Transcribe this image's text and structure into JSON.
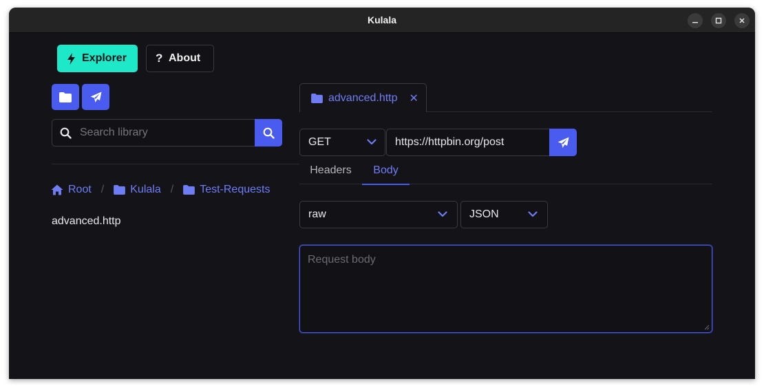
{
  "window": {
    "title": "Kulala"
  },
  "nav": {
    "explorer_label": "Explorer",
    "about_label": "About"
  },
  "sidebar": {
    "search_placeholder": "Search library",
    "breadcrumb": [
      {
        "label": "Root",
        "icon": "home-icon"
      },
      {
        "label": "Kulala",
        "icon": "folder-icon"
      },
      {
        "label": "Test-Requests",
        "icon": "folder-icon"
      }
    ],
    "files": [
      "advanced.http"
    ]
  },
  "editor": {
    "tab": {
      "label": "advanced.http",
      "icon": "folder-icon",
      "close_glyph": "✕"
    },
    "method": "GET",
    "url": "https://httpbin.org/post",
    "subtabs": [
      "Headers",
      "Body"
    ],
    "active_subtab": "Body",
    "body_type": "raw",
    "body_format": "JSON",
    "body_placeholder": "Request body"
  },
  "colors": {
    "accent": "#4a5bf0",
    "link": "#6f7df5",
    "explorer_bg": "#1de9c8",
    "window_bg": "#141418"
  }
}
